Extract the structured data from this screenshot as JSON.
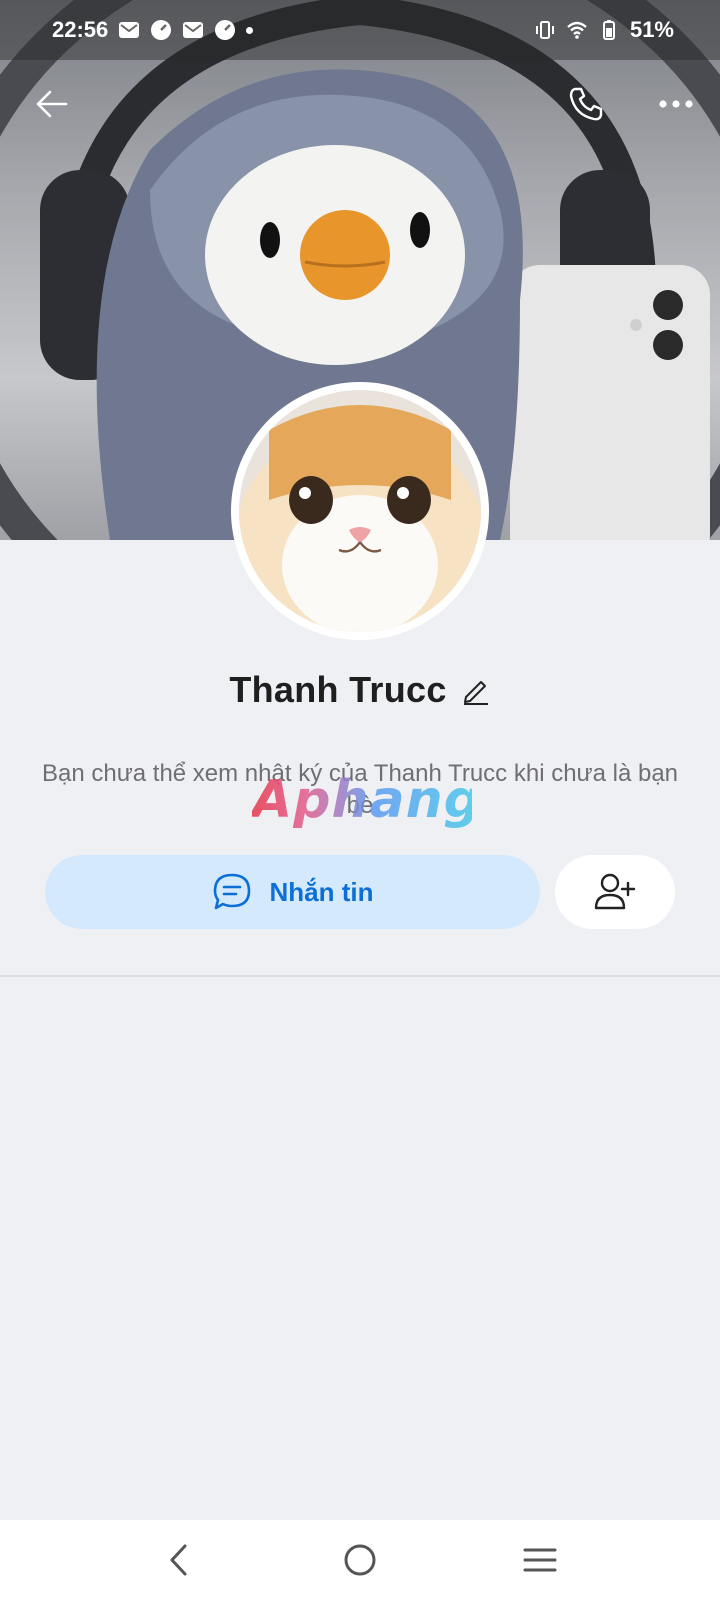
{
  "status_bar": {
    "time": "22:56",
    "battery": "51%"
  },
  "toolbar": {
    "back_icon": "arrow-left-icon",
    "call_icon": "phone-icon",
    "more_icon": "more-horizontal-icon"
  },
  "profile": {
    "name": "Thanh Trucc",
    "edit_icon": "pencil-icon",
    "info_text": "Bạn chưa thể xem nhật ký của Thanh Trucc khi chưa là bạn bè",
    "message_button_label": "Nhắn tin",
    "message_icon": "chat-bubble-icon",
    "add_friend_icon": "user-plus-icon"
  },
  "watermark": {
    "text": "Aphang"
  },
  "colors": {
    "accent": "#0b6fd6",
    "message_button_bg": "#d5e9fd",
    "background": "#eff0f4"
  }
}
